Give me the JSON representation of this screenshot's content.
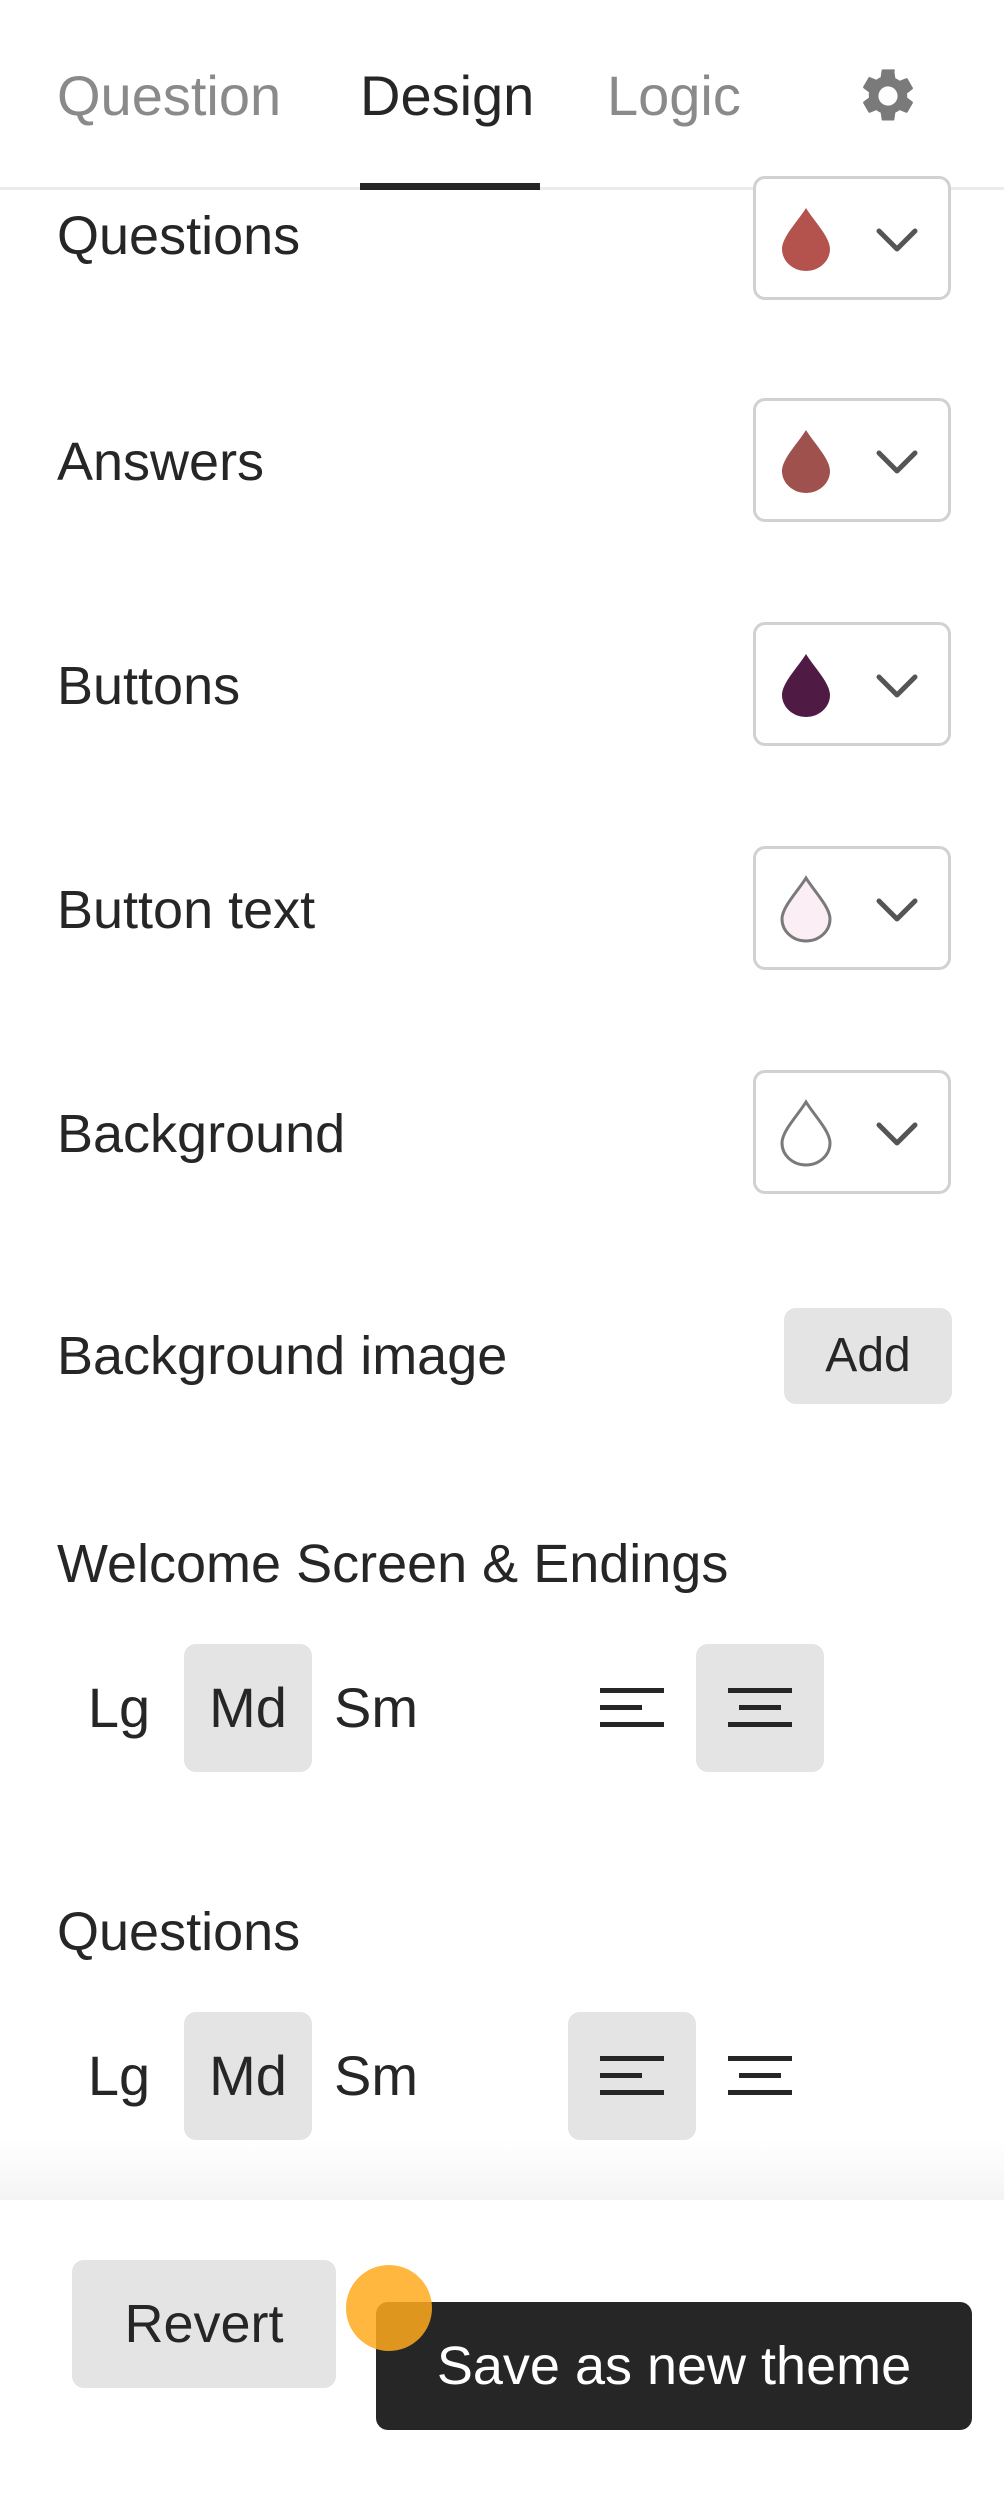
{
  "tabs": {
    "question": "Question",
    "design": "Design",
    "logic": "Logic"
  },
  "colors": {
    "questions": {
      "label": "Questions",
      "swatch": "#b4534e"
    },
    "answers": {
      "label": "Answers",
      "swatch": "#9e514d"
    },
    "buttons": {
      "label": "Buttons",
      "swatch": "#4f1a43"
    },
    "button_text": {
      "label": "Button text",
      "swatch": "#fbeef5"
    },
    "background": {
      "label": "Background",
      "swatch": "#ffffff"
    }
  },
  "background_image": {
    "label": "Background image",
    "button": "Add"
  },
  "welcome": {
    "label": "Welcome Screen & Endings",
    "sizes": [
      "Lg",
      "Md",
      "Sm"
    ],
    "selected_size": "Md",
    "selected_alignment": "center"
  },
  "questions_layout": {
    "label": "Questions",
    "sizes": [
      "Lg",
      "Md",
      "Sm"
    ],
    "selected_size": "Md",
    "selected_alignment": "left"
  },
  "footer": {
    "revert": "Revert",
    "save": "Save as new theme"
  },
  "icons": {
    "settings": "gear-icon",
    "color": "droplet-icon",
    "dropdown": "chevron-down-icon",
    "align_left": "align-left-icon",
    "align_center": "align-center-icon"
  }
}
